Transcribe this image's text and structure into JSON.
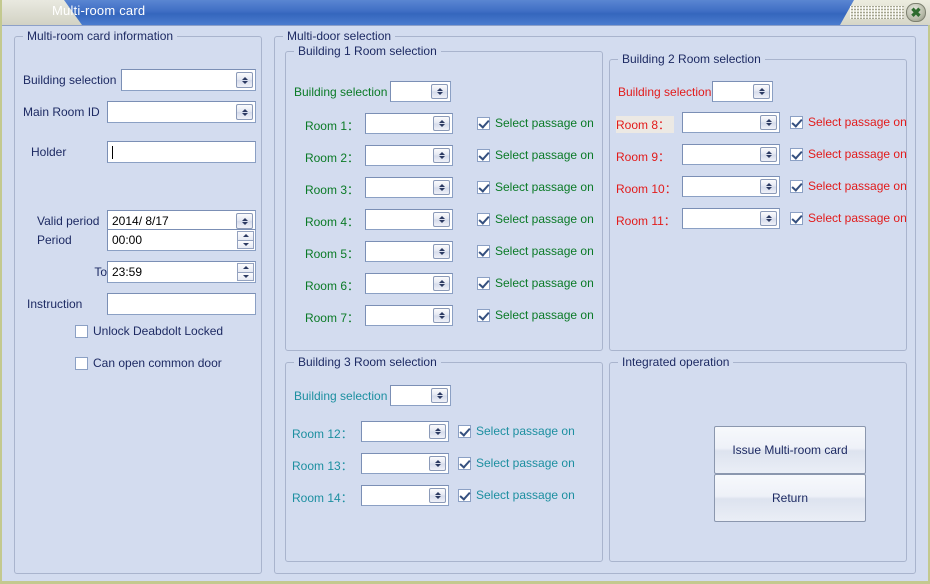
{
  "window": {
    "title": "Multi-room card",
    "close_icon": "close-icon",
    "close_glyph": "✖",
    "accent_title_bg": "#3f6ec4",
    "client_bg": "#d3dcef",
    "frame_border": "#c3c98f"
  },
  "card_info": {
    "group_title": "Multi-room card information",
    "building_selection_label": "Building selection",
    "building_selection_value": "",
    "main_room_id_label": "Main Room ID",
    "main_room_id_value": "",
    "holder_label": "Holder",
    "holder_value": "",
    "valid_period_label": "Valid period",
    "valid_period_value": "2014/  8/17",
    "period_label": "Period",
    "period_value": "00:00",
    "to_label": "To",
    "to_value": "23:59",
    "instruction_label": "Instruction",
    "instruction_value": "",
    "checkboxes": [
      {
        "label": "Unlock Deabdolt Locked",
        "checked": false
      },
      {
        "label": "Can open common door",
        "checked": false
      }
    ]
  },
  "multi_door": {
    "group_title": "Multi-door selection",
    "buildings": [
      {
        "group_title": "Building 1 Room selection",
        "color": "#0a7a26",
        "color_class": "t-green",
        "building_selection_label": "Building selection",
        "building_selection_value": "",
        "rooms": [
          {
            "label": "Room 1：",
            "value": "",
            "passage_label": "Select passage on",
            "checked": true
          },
          {
            "label": "Room 2：",
            "value": "",
            "passage_label": "Select passage on",
            "checked": true
          },
          {
            "label": "Room 3：",
            "value": "",
            "passage_label": "Select passage on",
            "checked": true
          },
          {
            "label": "Room 4：",
            "value": "",
            "passage_label": "Select passage on",
            "checked": true
          },
          {
            "label": "Room 5：",
            "value": "",
            "passage_label": "Select passage on",
            "checked": true
          },
          {
            "label": "Room 6：",
            "value": "",
            "passage_label": "Select passage on",
            "checked": true
          },
          {
            "label": "Room 7：",
            "value": "",
            "passage_label": "Select passage on",
            "checked": true
          }
        ]
      },
      {
        "group_title": "Building 2 Room selection",
        "color": "#e21b1b",
        "color_class": "t-red",
        "building_selection_label": "Building selection",
        "building_selection_value": "",
        "rooms": [
          {
            "label": "Room 8：",
            "value": "",
            "passage_label": "Select passage on",
            "checked": true
          },
          {
            "label": "Room 9：",
            "value": "",
            "passage_label": "Select passage on",
            "checked": true
          },
          {
            "label": "Room 10：",
            "value": "",
            "passage_label": "Select passage on",
            "checked": true
          },
          {
            "label": "Room 11：",
            "value": "",
            "passage_label": "Select passage on",
            "checked": true
          }
        ]
      },
      {
        "group_title": "Building 3 Room selection",
        "color": "#1c8fa0",
        "color_class": "t-teal",
        "building_selection_label": "Building selection",
        "building_selection_value": "",
        "rooms": [
          {
            "label": "Room 12：",
            "value": "",
            "passage_label": "Select passage on",
            "checked": true
          },
          {
            "label": "Room 13：",
            "value": "",
            "passage_label": "Select passage on",
            "checked": true
          },
          {
            "label": "Room 14：",
            "value": "",
            "passage_label": "Select passage on",
            "checked": true
          }
        ]
      }
    ]
  },
  "integrated": {
    "group_title": "Integrated operation",
    "issue_button": "Issue Multi-room card",
    "return_button": "Return"
  }
}
